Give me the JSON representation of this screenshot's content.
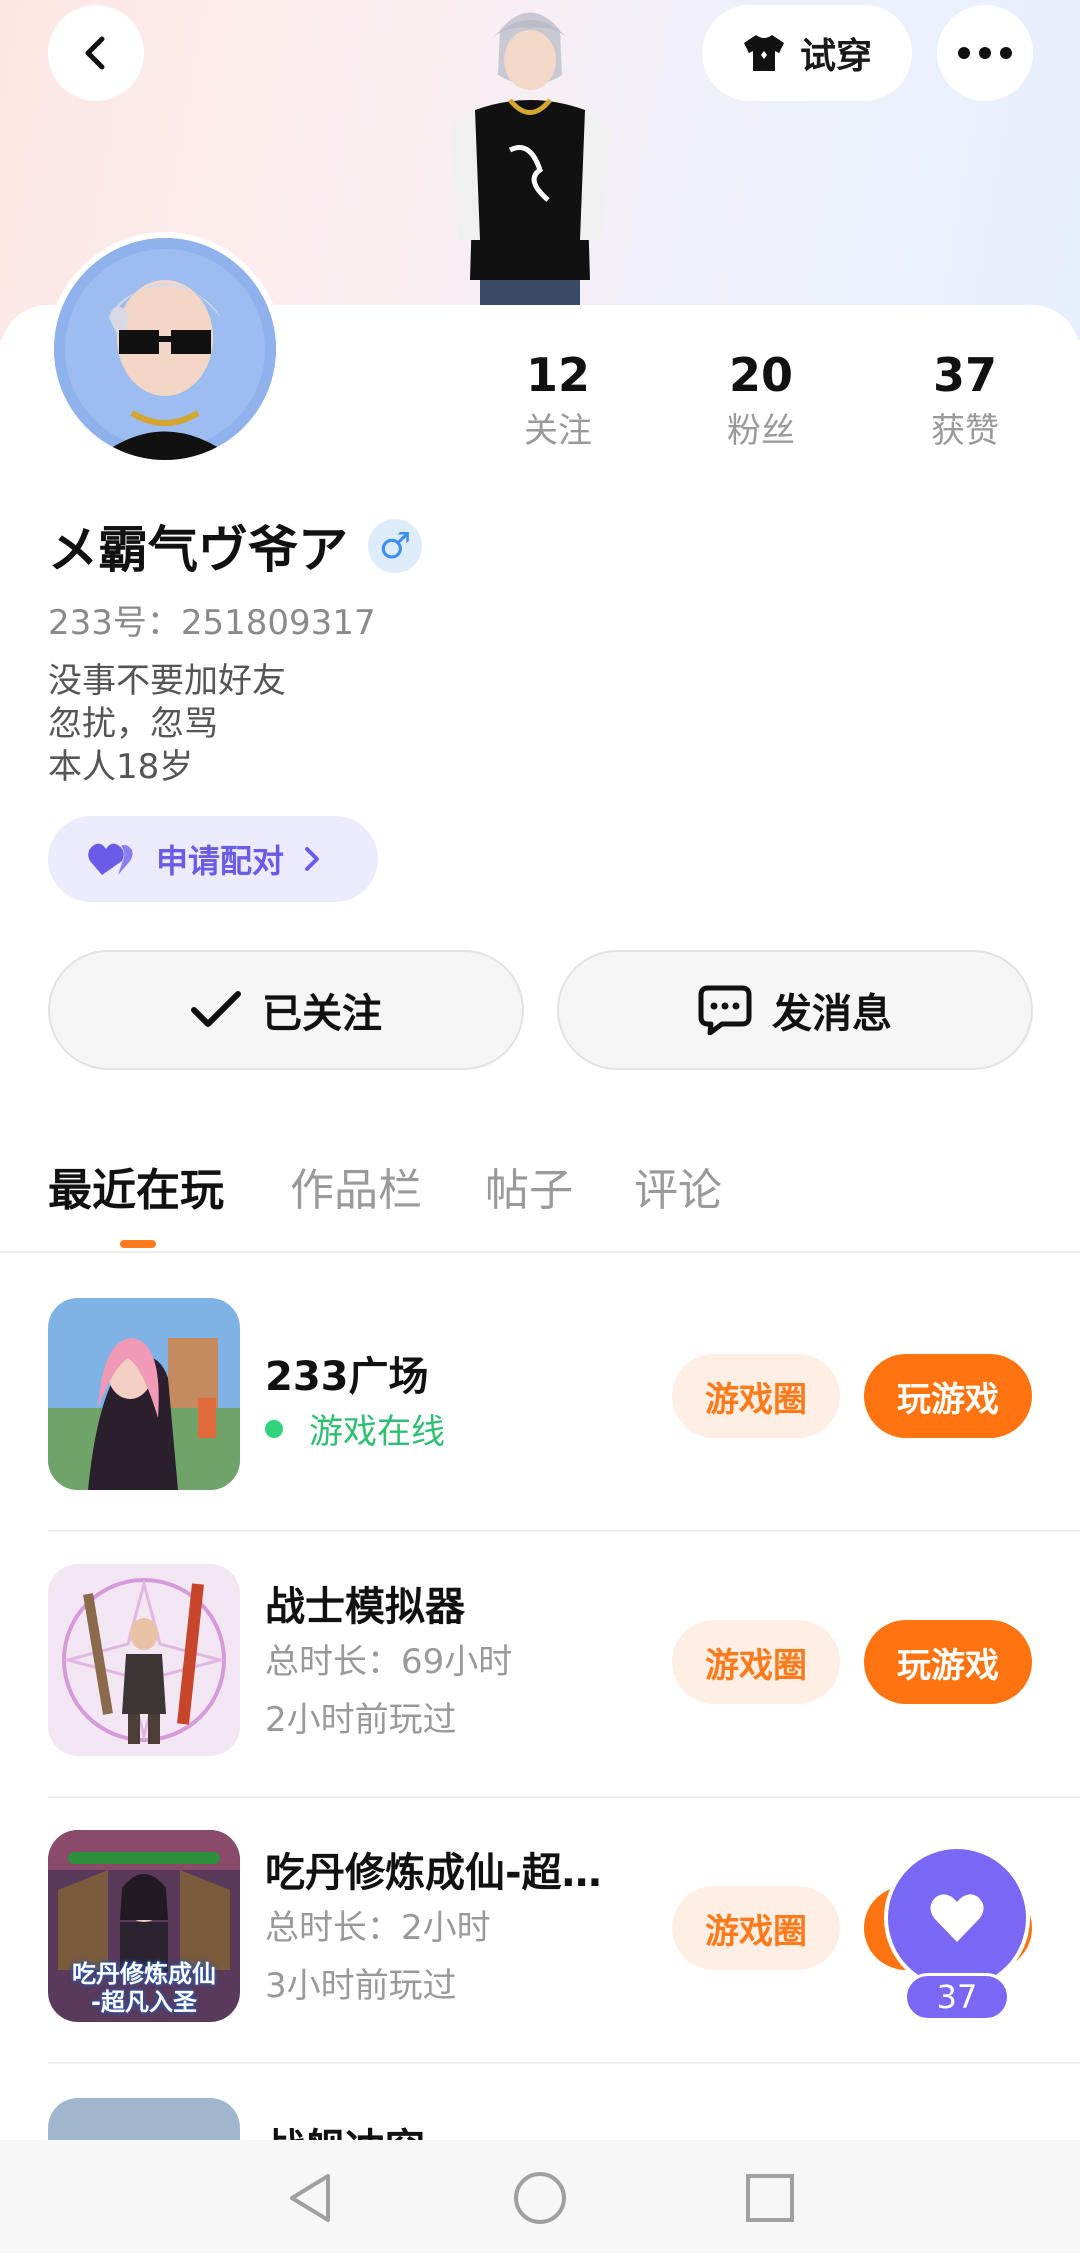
{
  "header": {
    "try_on_label": "试穿"
  },
  "profile": {
    "nickname": "メ霸气ヴ爷ア",
    "gender_symbol": "♂",
    "uid": "233号：251809317",
    "bio_lines": [
      "没事不要加好友",
      "忽扰，忽骂",
      "本人18岁"
    ],
    "stats": [
      {
        "value": "12",
        "label": "关注"
      },
      {
        "value": "20",
        "label": "粉丝"
      },
      {
        "value": "37",
        "label": "获赞"
      }
    ],
    "pair_label": "申请配对",
    "followed_label": "已关注",
    "message_label": "发消息"
  },
  "tabs": [
    {
      "label": "最近在玩",
      "active": true
    },
    {
      "label": "作品栏",
      "active": false
    },
    {
      "label": "帖子",
      "active": false
    },
    {
      "label": "评论",
      "active": false
    }
  ],
  "games": [
    {
      "title": "233广场",
      "status": "游戏在线",
      "circle_label": "游戏圈",
      "play_label": "玩游戏"
    },
    {
      "title": "战士模拟器",
      "playtime": "总时长：69小时",
      "last_played": "2小时前玩过",
      "circle_label": "游戏圈",
      "play_label": "玩游戏"
    },
    {
      "title": "吃丹修炼成仙-超…",
      "playtime": "总时长：2小时",
      "last_played": "3小时前玩过",
      "circle_label": "游戏圈",
      "play_label": "玩游戏",
      "icon_text": [
        "吃丹修炼成仙",
        "-超凡入圣"
      ]
    },
    {
      "title": "战舰冲突"
    }
  ],
  "like_float": {
    "count": "37"
  },
  "colors": {
    "accent": "#ff7410",
    "purple": "#7a67f4",
    "online": "#2fbf73"
  }
}
